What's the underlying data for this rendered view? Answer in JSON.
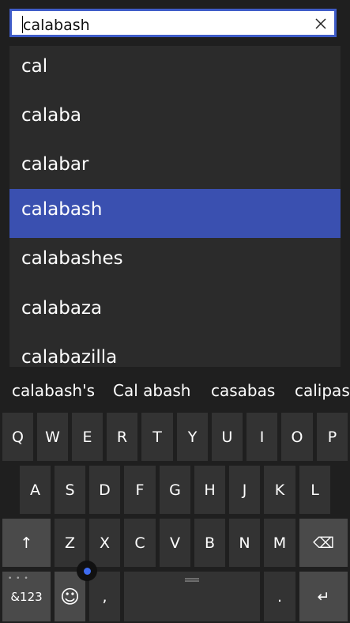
{
  "search": {
    "value": "calabash"
  },
  "suggestions": [
    "cal",
    "calaba",
    "calabar",
    "calabash",
    "calabashes",
    "calabaza",
    "calabazilla"
  ],
  "selected_index": 3,
  "predictions": [
    "calabash's",
    "Cal abash",
    "casabas",
    "calipash"
  ],
  "keyboard": {
    "row1": [
      "Q",
      "W",
      "E",
      "R",
      "T",
      "Y",
      "U",
      "I",
      "O",
      "P"
    ],
    "row2": [
      "A",
      "S",
      "D",
      "F",
      "G",
      "H",
      "J",
      "K",
      "L"
    ],
    "row3": [
      "Z",
      "X",
      "C",
      "V",
      "B",
      "N",
      "M"
    ],
    "shift_glyph": "↑",
    "backspace_glyph": "⌫",
    "numbers_label": "&123",
    "emoji_glyph": "☺",
    "comma_label": ",",
    "period_label": ".",
    "enter_glyph": "↵",
    "dots_label": "• • •"
  },
  "colors": {
    "accent": "#3f5cc8",
    "selected": "#3a50b0",
    "panel": "#2b2b2b",
    "key": "#333333",
    "func_key": "#4a4a4a"
  }
}
